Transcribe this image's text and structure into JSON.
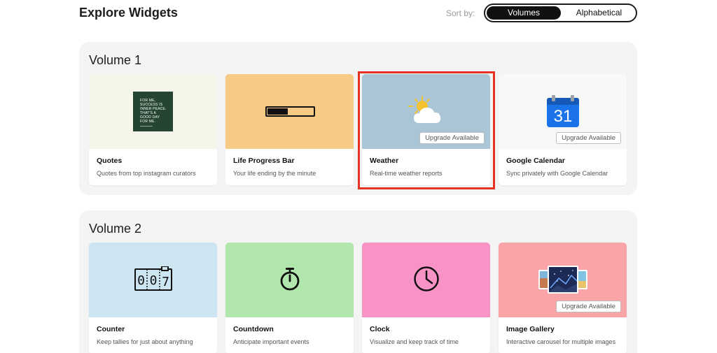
{
  "header": {
    "title": "Explore Widgets",
    "sort_label": "Sort by:",
    "sort_options": [
      {
        "label": "Volumes",
        "active": true
      },
      {
        "label": "Alphabetical",
        "active": false
      }
    ]
  },
  "volumes": [
    {
      "title": "Volume 1",
      "cards": [
        {
          "name": "Quotes",
          "desc": "Quotes from top instagram curators",
          "bg": "#f5f5ea",
          "quote_lines": [
            "FOR ME,",
            "SUCCESS IS",
            "INNER PEACE.",
            "THAT'S A",
            "GOOD DAY",
            "FOR ME."
          ]
        },
        {
          "name": "Life Progress Bar",
          "desc": "Your life ending by the minute",
          "bg": "#f6cb86",
          "progress": 0.45
        },
        {
          "name": "Weather",
          "desc": "Real-time weather reports",
          "bg": "#aac6d6",
          "badge": "Upgrade Available",
          "highlighted": true
        },
        {
          "name": "Google Calendar",
          "desc": "Sync privately with Google Calendar",
          "bg": "#f8f8f8",
          "badge": "Upgrade Available",
          "icon_text": "31"
        }
      ]
    },
    {
      "title": "Volume 2",
      "cards": [
        {
          "name": "Counter",
          "desc": "Keep tallies for just about anything",
          "bg": "#cde4f1",
          "digits": [
            "0",
            "0",
            "7"
          ]
        },
        {
          "name": "Countdown",
          "desc": "Anticipate important events",
          "bg": "#b1e6ad"
        },
        {
          "name": "Clock",
          "desc": "Visualize and keep track of time",
          "bg": "#f893c6"
        },
        {
          "name": "Image Gallery",
          "desc": "Interactive carousel for multiple images",
          "bg": "#f9a4a6",
          "badge": "Upgrade Available"
        }
      ]
    }
  ],
  "colors": {
    "accent": "#111111",
    "highlight": "#e53323",
    "panel": "#f4f4f5",
    "calendar_blue": "#1a73e8"
  },
  "icons": [
    "quote-card-icon",
    "progress-bar-icon",
    "sun-cloud-icon",
    "calendar-icon",
    "counter-icon",
    "stopwatch-icon",
    "clock-icon",
    "gallery-icon"
  ]
}
